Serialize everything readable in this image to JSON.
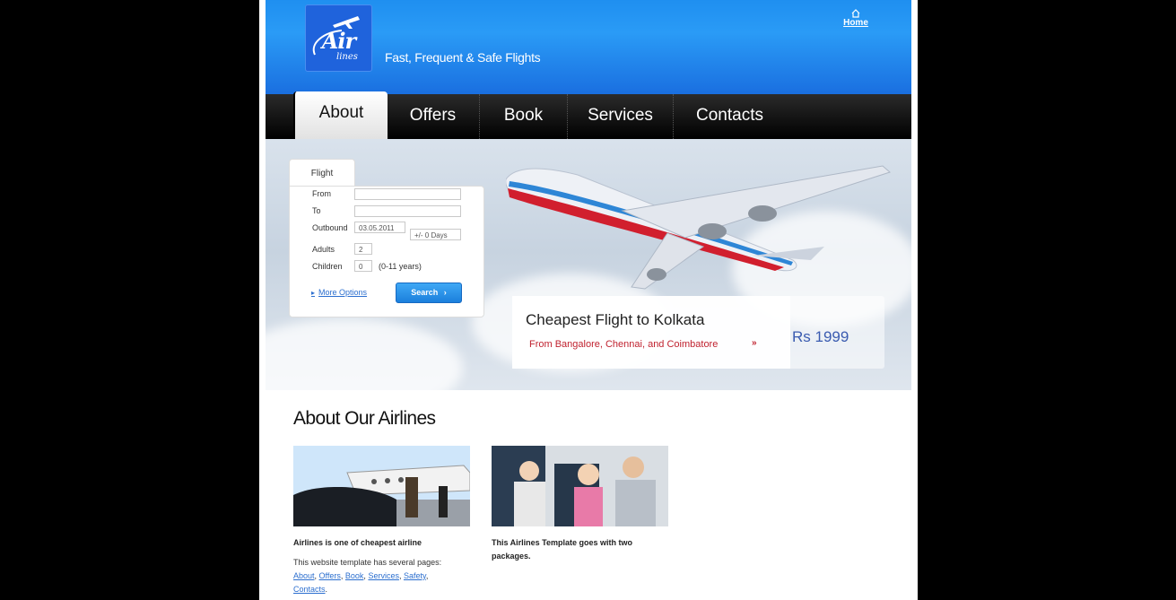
{
  "header": {
    "logo_text": "Air",
    "logo_sub": "lines",
    "tagline": "Fast, Frequent & Safe Flights",
    "home_label": "Home"
  },
  "nav": {
    "items": [
      {
        "label": "About",
        "active": true
      },
      {
        "label": "Offers",
        "active": false
      },
      {
        "label": "Book",
        "active": false
      },
      {
        "label": "Services",
        "active": false
      },
      {
        "label": "Contacts",
        "active": false
      }
    ]
  },
  "flight_form": {
    "tab_label": "Flight",
    "from_label": "From",
    "from_value": "",
    "to_label": "To",
    "to_value": "",
    "outbound_label": "Outbound",
    "outbound_value": "03.05.2011",
    "days_value": "+/- 0 Days",
    "adults_label": "Adults",
    "adults_value": "2",
    "children_label": "Children",
    "children_value": "0",
    "children_note": "(0-11 years)",
    "more_options": "More Options",
    "search_label": "Search"
  },
  "promo": {
    "title": "Cheapest Flight to Kolkata",
    "subtitle": "From Bangalore, Chennai, and Coimbatore",
    "arrow": "»",
    "price": "Rs 1999"
  },
  "about": {
    "title": "About Our Airlines",
    "col1": {
      "heading": "Airlines is one of cheapest airline",
      "text": "This website template has several pages:",
      "links": [
        "About",
        "Offers",
        "Book",
        "Services",
        "Safety",
        "Contacts"
      ]
    },
    "col2": {
      "heading_line1": "This Airlines Template goes with two",
      "heading_line2": "packages."
    }
  },
  "colors": {
    "header_blue": "#1f8ff0",
    "nav_black": "#111111",
    "promo_red": "#c0222f",
    "price_blue": "#3a5bb0",
    "link_blue": "#2c6fcf"
  }
}
